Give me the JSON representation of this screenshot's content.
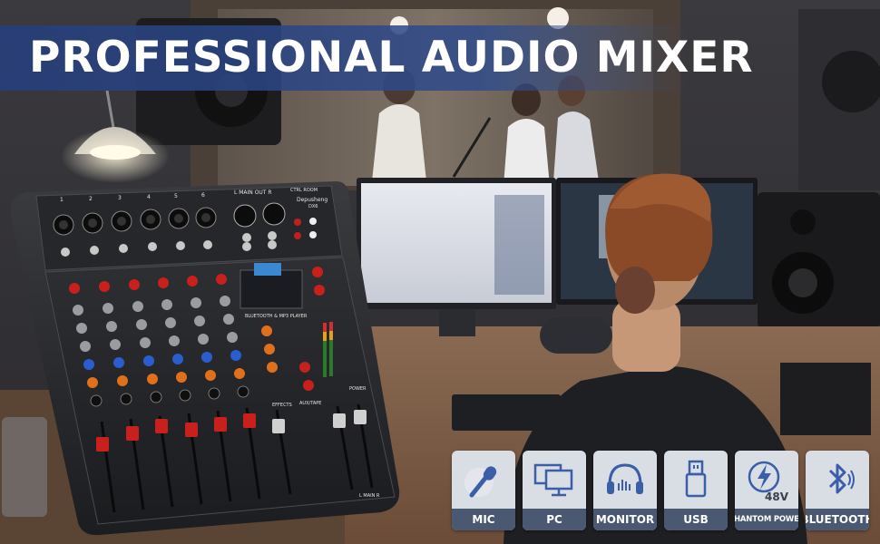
{
  "banner": {
    "title": "PROFESSIONAL AUDIO MIXER"
  },
  "mixer": {
    "brand": "Depusheng",
    "model": "DX6",
    "player_label": "BLUETOOTH & MP3 PLAYER",
    "main_out_label": "L MAIN OUT R",
    "ctrl_room_label": "CTRL ROOM",
    "effects_label": "EFFECTS",
    "aux_tape_label": "AUX/TAPE",
    "power_label": "POWER",
    "main_label": "L MAIN R",
    "channel_numbers": [
      "1",
      "2",
      "3",
      "4",
      "5",
      "6"
    ]
  },
  "features": [
    {
      "label": "MIC",
      "icon": "microphone-icon"
    },
    {
      "label": "PC",
      "icon": "computer-monitors-icon"
    },
    {
      "label": "MONITOR",
      "icon": "headphones-icon"
    },
    {
      "label": "USB",
      "icon": "usb-icon"
    },
    {
      "label": "PHANTOM POWER",
      "icon": "phantom-power-icon",
      "voltage": "48V"
    },
    {
      "label": "BLUETOOTH",
      "icon": "bluetooth-icon"
    }
  ],
  "colors": {
    "banner": "#304c8c",
    "feature_label_bg": "#4a5872",
    "knob_red": "#c8201c",
    "knob_blue": "#2a5ed0",
    "knob_orange": "#e0701c"
  }
}
